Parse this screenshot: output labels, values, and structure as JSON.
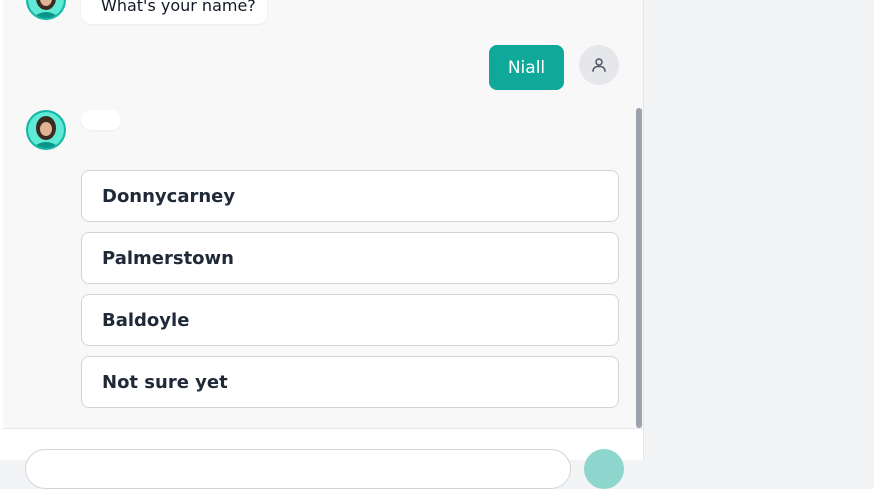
{
  "chat": {
    "messages": [
      {
        "from": "bot",
        "text": "What's your name?"
      },
      {
        "from": "user",
        "text": "Niall"
      },
      {
        "from": "bot",
        "text": ""
      }
    ],
    "options": [
      "Donnycarney",
      "Palmerstown",
      "Baldoyle",
      "Not sure yet"
    ]
  },
  "icons": {
    "user_avatar": "person-icon",
    "bot_avatar": "assistant-avatar",
    "send": "send-icon"
  },
  "colors": {
    "accent": "#10a898",
    "send_disabled": "#8fd6cf",
    "panel_bg": "#f8f8f8",
    "page_bg": "#f3f4f6"
  }
}
